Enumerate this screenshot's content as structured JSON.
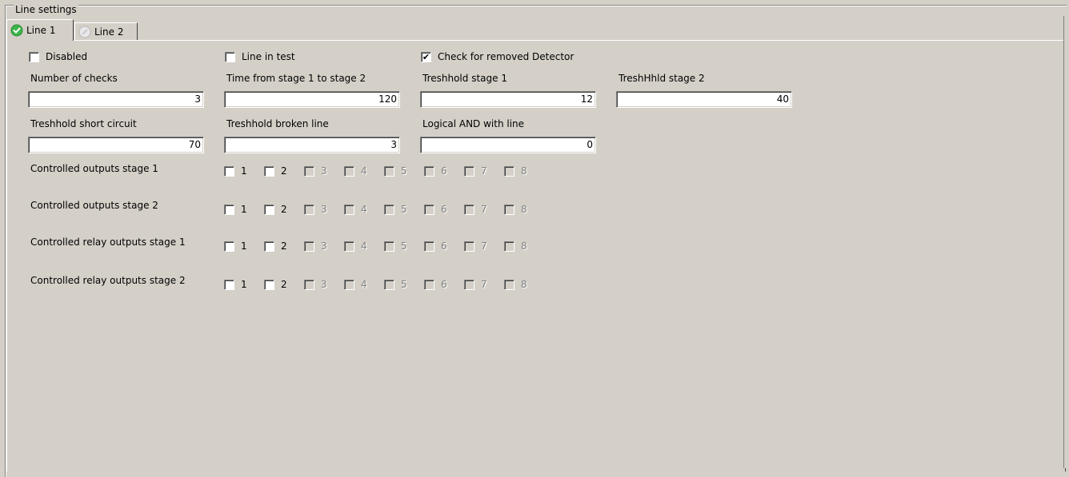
{
  "group": {
    "title": "Line settings"
  },
  "tabs": [
    {
      "label": "Line 1",
      "icon": "check-circle-icon",
      "active": true
    },
    {
      "label": "Line 2",
      "icon": "disabled-circle-icon",
      "active": false
    }
  ],
  "flags": [
    {
      "label": "Disabled",
      "checked": false
    },
    {
      "label": "Line in test",
      "checked": false
    },
    {
      "label": "Check for removed Detector",
      "checked": true
    }
  ],
  "fields_row1": [
    {
      "label": "Number of checks",
      "value": "3"
    },
    {
      "label": "Time from stage 1 to stage 2",
      "value": "120"
    },
    {
      "label": "Treshhold stage 1",
      "value": "12"
    },
    {
      "label": "TreshHhld stage 2",
      "value": "40"
    }
  ],
  "fields_row2": [
    {
      "label": "Treshhold short circuit",
      "value": "70"
    },
    {
      "label": "Treshhold broken line",
      "value": "3"
    },
    {
      "label": "Logical AND with line",
      "value": "0"
    }
  ],
  "outputs": [
    {
      "label": "Controlled outputs stage 1"
    },
    {
      "label": "Controlled outputs stage 2"
    },
    {
      "label": "Controlled relay outputs stage 1"
    },
    {
      "label": "Controlled relay outputs stage 2"
    }
  ],
  "output_numbers": [
    "1",
    "2",
    "3",
    "4",
    "5",
    "6",
    "7",
    "8"
  ],
  "enabled_outputs": 2,
  "colors": {
    "background": "#d4d0c8",
    "check_green": "#3cb44a"
  }
}
